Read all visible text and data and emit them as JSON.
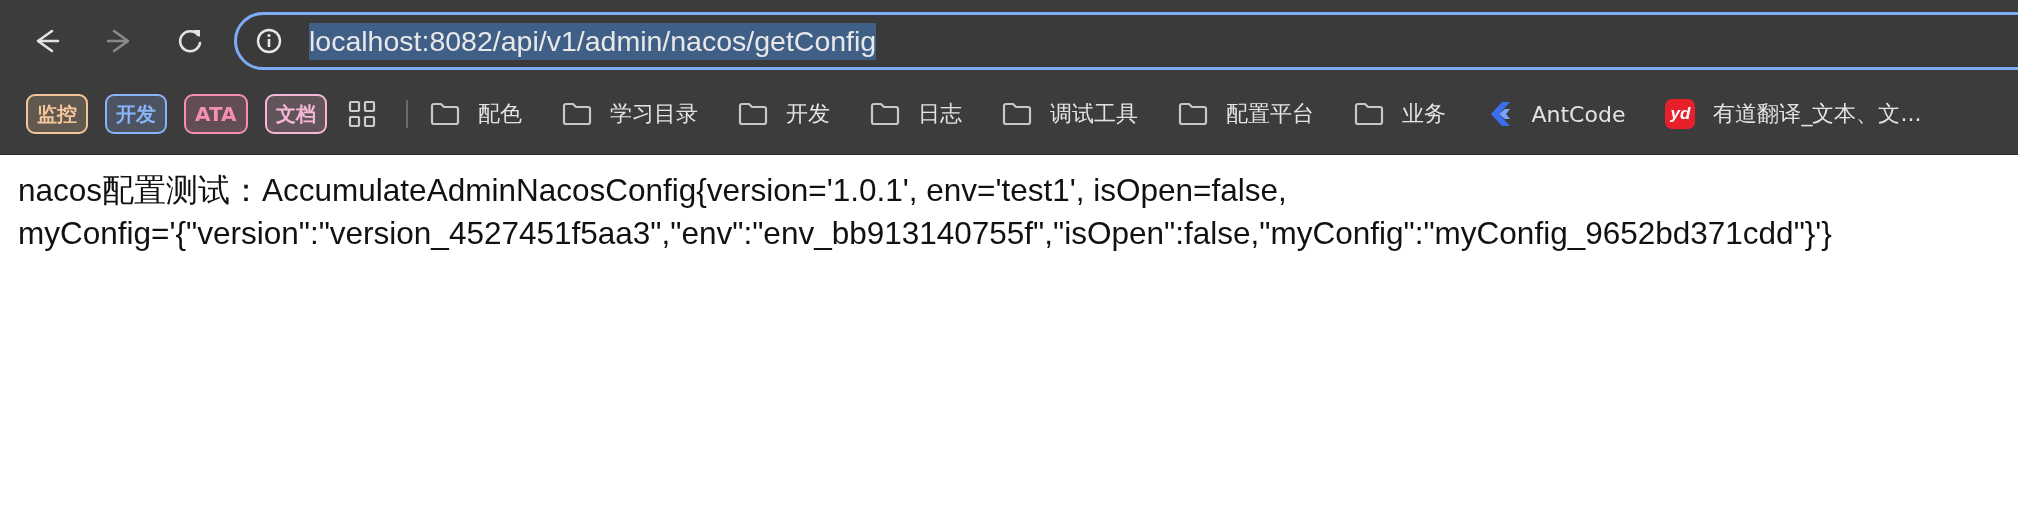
{
  "toolbar": {
    "back": {
      "disabled": false
    },
    "forward": {
      "disabled": true
    },
    "address_bar": {
      "url": "localhost:8082/api/v1/admin/nacos/getConfig",
      "selected": true
    }
  },
  "bookmarks": [
    {
      "kind": "chip",
      "label": "监控",
      "color": "#f3c69a"
    },
    {
      "kind": "chip",
      "label": "开发",
      "color": "#8ab4f8"
    },
    {
      "kind": "chip",
      "label": "ATA",
      "color": "#f48fb1"
    },
    {
      "kind": "chip",
      "label": "文档",
      "color": "#f5b8d8"
    },
    {
      "kind": "apps"
    },
    {
      "kind": "folder",
      "label": "配色"
    },
    {
      "kind": "folder",
      "label": "学习目录"
    },
    {
      "kind": "folder",
      "label": "开发"
    },
    {
      "kind": "folder",
      "label": "日志"
    },
    {
      "kind": "folder",
      "label": "调试工具"
    },
    {
      "kind": "folder",
      "label": "配置平台"
    },
    {
      "kind": "folder",
      "label": "业务"
    },
    {
      "kind": "chevron",
      "label": "AntCode"
    },
    {
      "kind": "badge",
      "label": "有道翻译_文本、文...",
      "logo_text": "yd"
    }
  ],
  "content": {
    "text": "nacos配置测试：AccumulateAdminNacosConfig{version='1.0.1', env='test1', isOpen=false, myConfig='{\"version\":\"version_4527451f5aa3\",\"env\":\"env_bb913140755f\",\"isOpen\":false,\"myConfig\":\"myConfig_9652bd371cdd\"}'}"
  }
}
